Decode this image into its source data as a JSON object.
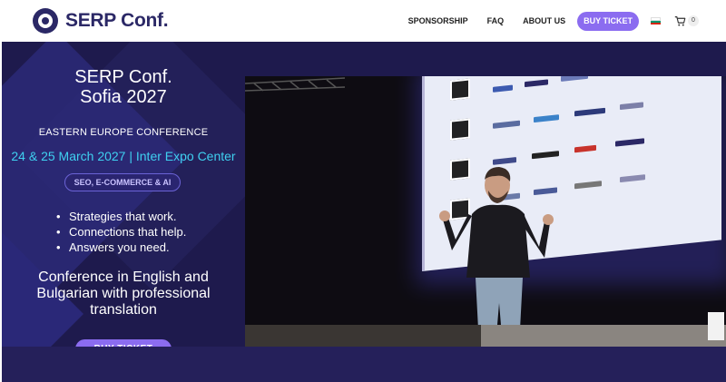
{
  "brand": {
    "name": "SERP Conf."
  },
  "nav": {
    "items": [
      "SPONSORSHIP",
      "FAQ",
      "ABOUT US"
    ],
    "cta": "BUY TICKET",
    "cart_count": "0"
  },
  "hero": {
    "title_line1": "SERP Conf.",
    "title_line2": "Sofia 2027",
    "subtitle": "EASTERN EUROPE CONFERENCE",
    "date_venue": "24 & 25 March 2027 | Inter Expo Center",
    "badge": "SEO, E-COMMERCE & AI",
    "bullets": [
      "Strategies that work.",
      "Connections that help.",
      "Answers you need."
    ],
    "language_note_line1": "Conference in English and",
    "language_note_line2": "Bulgarian with professional",
    "language_note_line3": "translation",
    "cta": "BUY TICKET"
  },
  "colors": {
    "brand_navy": "#2b2866",
    "accent_purple": "#8b6cf0",
    "hero_bg": "#1e1a4d",
    "date_cyan": "#3fd0f0"
  },
  "icons": [
    "logo-mark-icon",
    "bulgaria-flag-icon",
    "cart-icon"
  ]
}
